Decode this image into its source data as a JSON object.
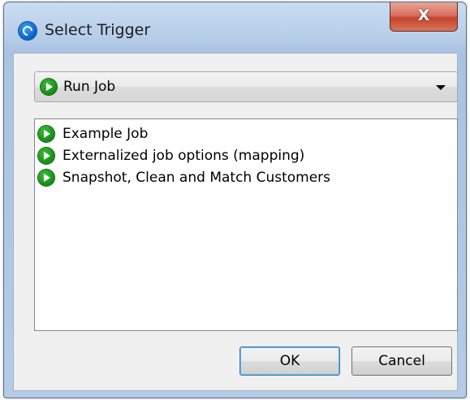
{
  "window": {
    "title": "Select Trigger",
    "close_label": "X"
  },
  "trigger_type": {
    "selected": "Run Job",
    "icon": "play-icon"
  },
  "jobs": [
    {
      "label": "Example Job",
      "icon": "play-icon"
    },
    {
      "label": "Externalized job options (mapping)",
      "icon": "play-icon"
    },
    {
      "label": "Snapshot, Clean and Match Customers",
      "icon": "play-icon"
    }
  ],
  "buttons": {
    "ok_label": "OK",
    "cancel_label": "Cancel"
  },
  "colors": {
    "play_icon": "#128a14",
    "close_button": "#c6442c",
    "ok_focus_border": "#3c7fb1"
  }
}
